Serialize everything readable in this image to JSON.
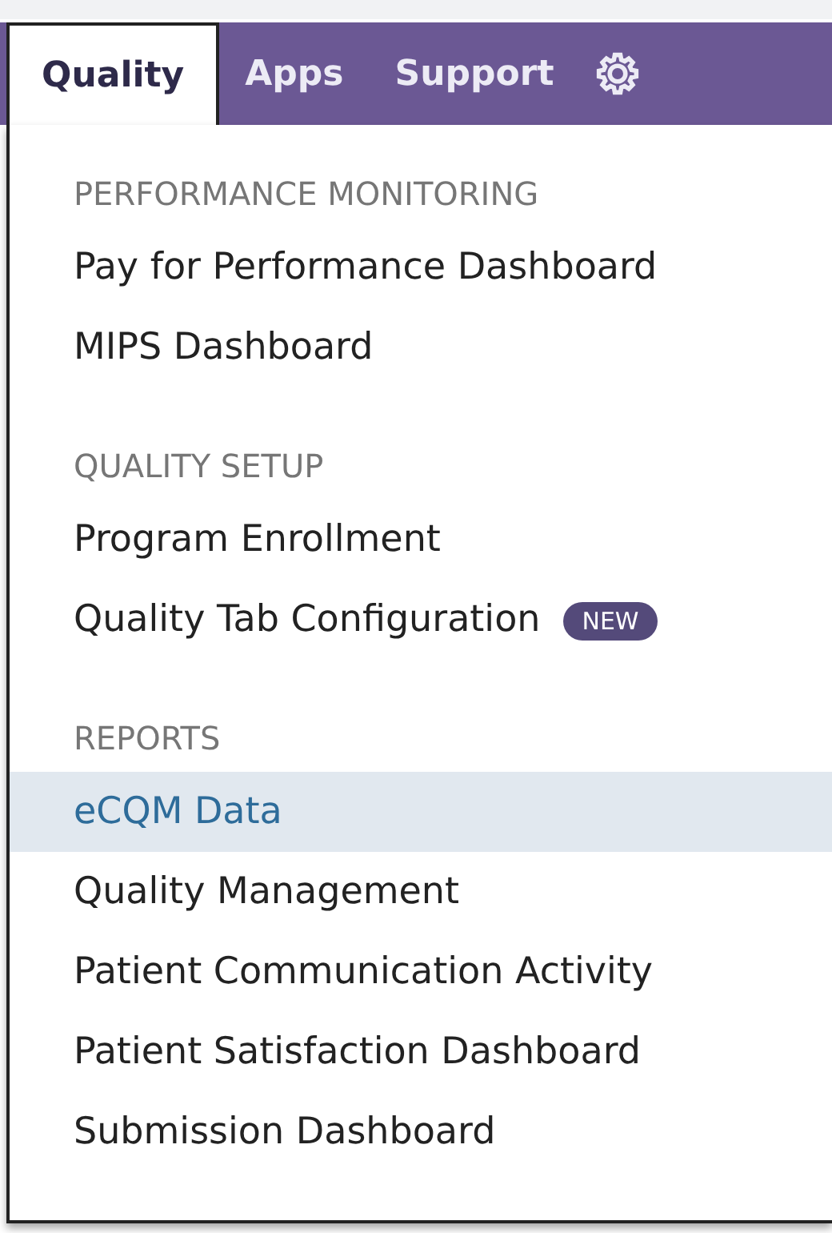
{
  "navbar": {
    "tabs": [
      {
        "label": "Quality",
        "selected": true
      },
      {
        "label": "Apps",
        "selected": false
      },
      {
        "label": "Support",
        "selected": false
      }
    ]
  },
  "menu": {
    "sections": [
      {
        "header": "PERFORMANCE MONITORING",
        "items": [
          {
            "label": "Pay for Performance Dashboard",
            "selected": false
          },
          {
            "label": "MIPS Dashboard",
            "selected": false
          }
        ]
      },
      {
        "header": "QUALITY SETUP",
        "items": [
          {
            "label": "Program Enrollment",
            "selected": false
          },
          {
            "label": "Quality Tab Configuration",
            "selected": false,
            "badge": "NEW"
          }
        ]
      },
      {
        "header": "REPORTS",
        "items": [
          {
            "label": "eCQM Data",
            "selected": true
          },
          {
            "label": "Quality Management",
            "selected": false
          },
          {
            "label": "Patient Communication Activity",
            "selected": false
          },
          {
            "label": "Patient Satisfaction Dashboard",
            "selected": false
          },
          {
            "label": "Submission Dashboard",
            "selected": false
          }
        ]
      }
    ]
  }
}
